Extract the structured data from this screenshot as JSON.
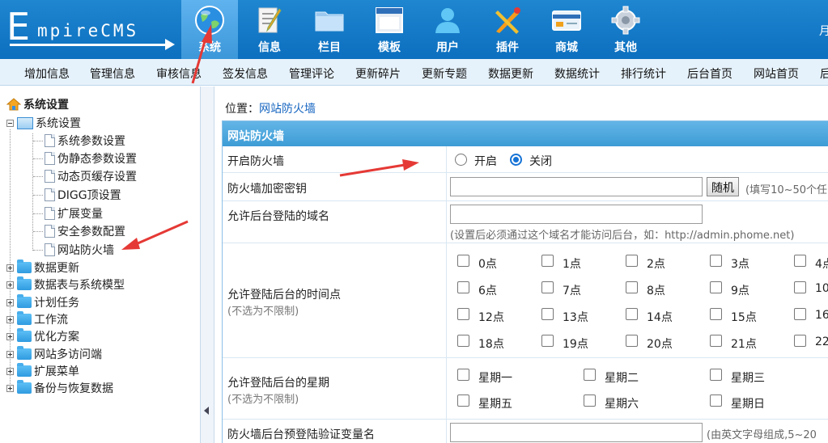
{
  "logo": {
    "big": "E",
    "word": "mpireCMS"
  },
  "nav": [
    {
      "label": "系统",
      "icon": "globe-icon",
      "active": true
    },
    {
      "label": "信息",
      "icon": "document-pen-icon"
    },
    {
      "label": "栏目",
      "icon": "folder-icon"
    },
    {
      "label": "模板",
      "icon": "window-icon"
    },
    {
      "label": "用户",
      "icon": "user-icon"
    },
    {
      "label": "插件",
      "icon": "tools-icon"
    },
    {
      "label": "商城",
      "icon": "card-icon"
    },
    {
      "label": "其他",
      "icon": "gear-icon"
    }
  ],
  "header_right": "月",
  "subnav": [
    "增加信息",
    "管理信息",
    "审核信息",
    "签发信息",
    "管理评论",
    "更新碎片",
    "更新专题",
    "数据更新",
    "数据统计",
    "排行统计",
    "后台首页",
    "网站首页",
    "后"
  ],
  "sidebar": {
    "root": "系统设置",
    "group": "系统设置",
    "children": [
      "系统参数设置",
      "伪静态参数设置",
      "动态页缓存设置",
      "DIGG顶设置",
      "扩展变量",
      "安全参数配置",
      "网站防火墙"
    ],
    "folders": [
      "数据更新",
      "数据表与系统模型",
      "计划任务",
      "工作流",
      "优化方案",
      "网站多访问端",
      "扩展菜单",
      "备份与恢复数据"
    ]
  },
  "breadcrumb": {
    "prefix": "位置：",
    "link": "网站防火墙"
  },
  "panel": {
    "title": "网站防火墙",
    "enable": {
      "label": "开启防火墙",
      "on": "开启",
      "off": "关闭",
      "selected": "关闭"
    },
    "key": {
      "label": "防火墙加密密钥",
      "button": "随机",
      "hint": "(填写10~50个任"
    },
    "domain": {
      "label": "允许后台登陆的域名",
      "hint": "(设置后必须通过这个域名才能访问后台，如：http://admin.phome.net)"
    },
    "hours": {
      "label": "允许登陆后台的时间点",
      "sub": "(不选为不限制)",
      "items": [
        "0点",
        "1点",
        "2点",
        "3点",
        "4点",
        "6点",
        "7点",
        "8点",
        "9点",
        "10",
        "12点",
        "13点",
        "14点",
        "15点",
        "16",
        "18点",
        "19点",
        "20点",
        "21点",
        "22"
      ]
    },
    "weekdays": {
      "label": "允许登陆后台的星期",
      "sub": "(不选为不限制)",
      "items": [
        "星期一",
        "星期二",
        "星期三",
        "星期五",
        "星期六",
        "星期日"
      ]
    },
    "varname": {
      "label": "防火墙后台预登陆验证变量名",
      "hint": "(由英文字母组成,5~20"
    }
  },
  "colors": {
    "header": "#0c6fbf",
    "annotation": "#e53935",
    "panel_head": "#3d9cd6"
  }
}
